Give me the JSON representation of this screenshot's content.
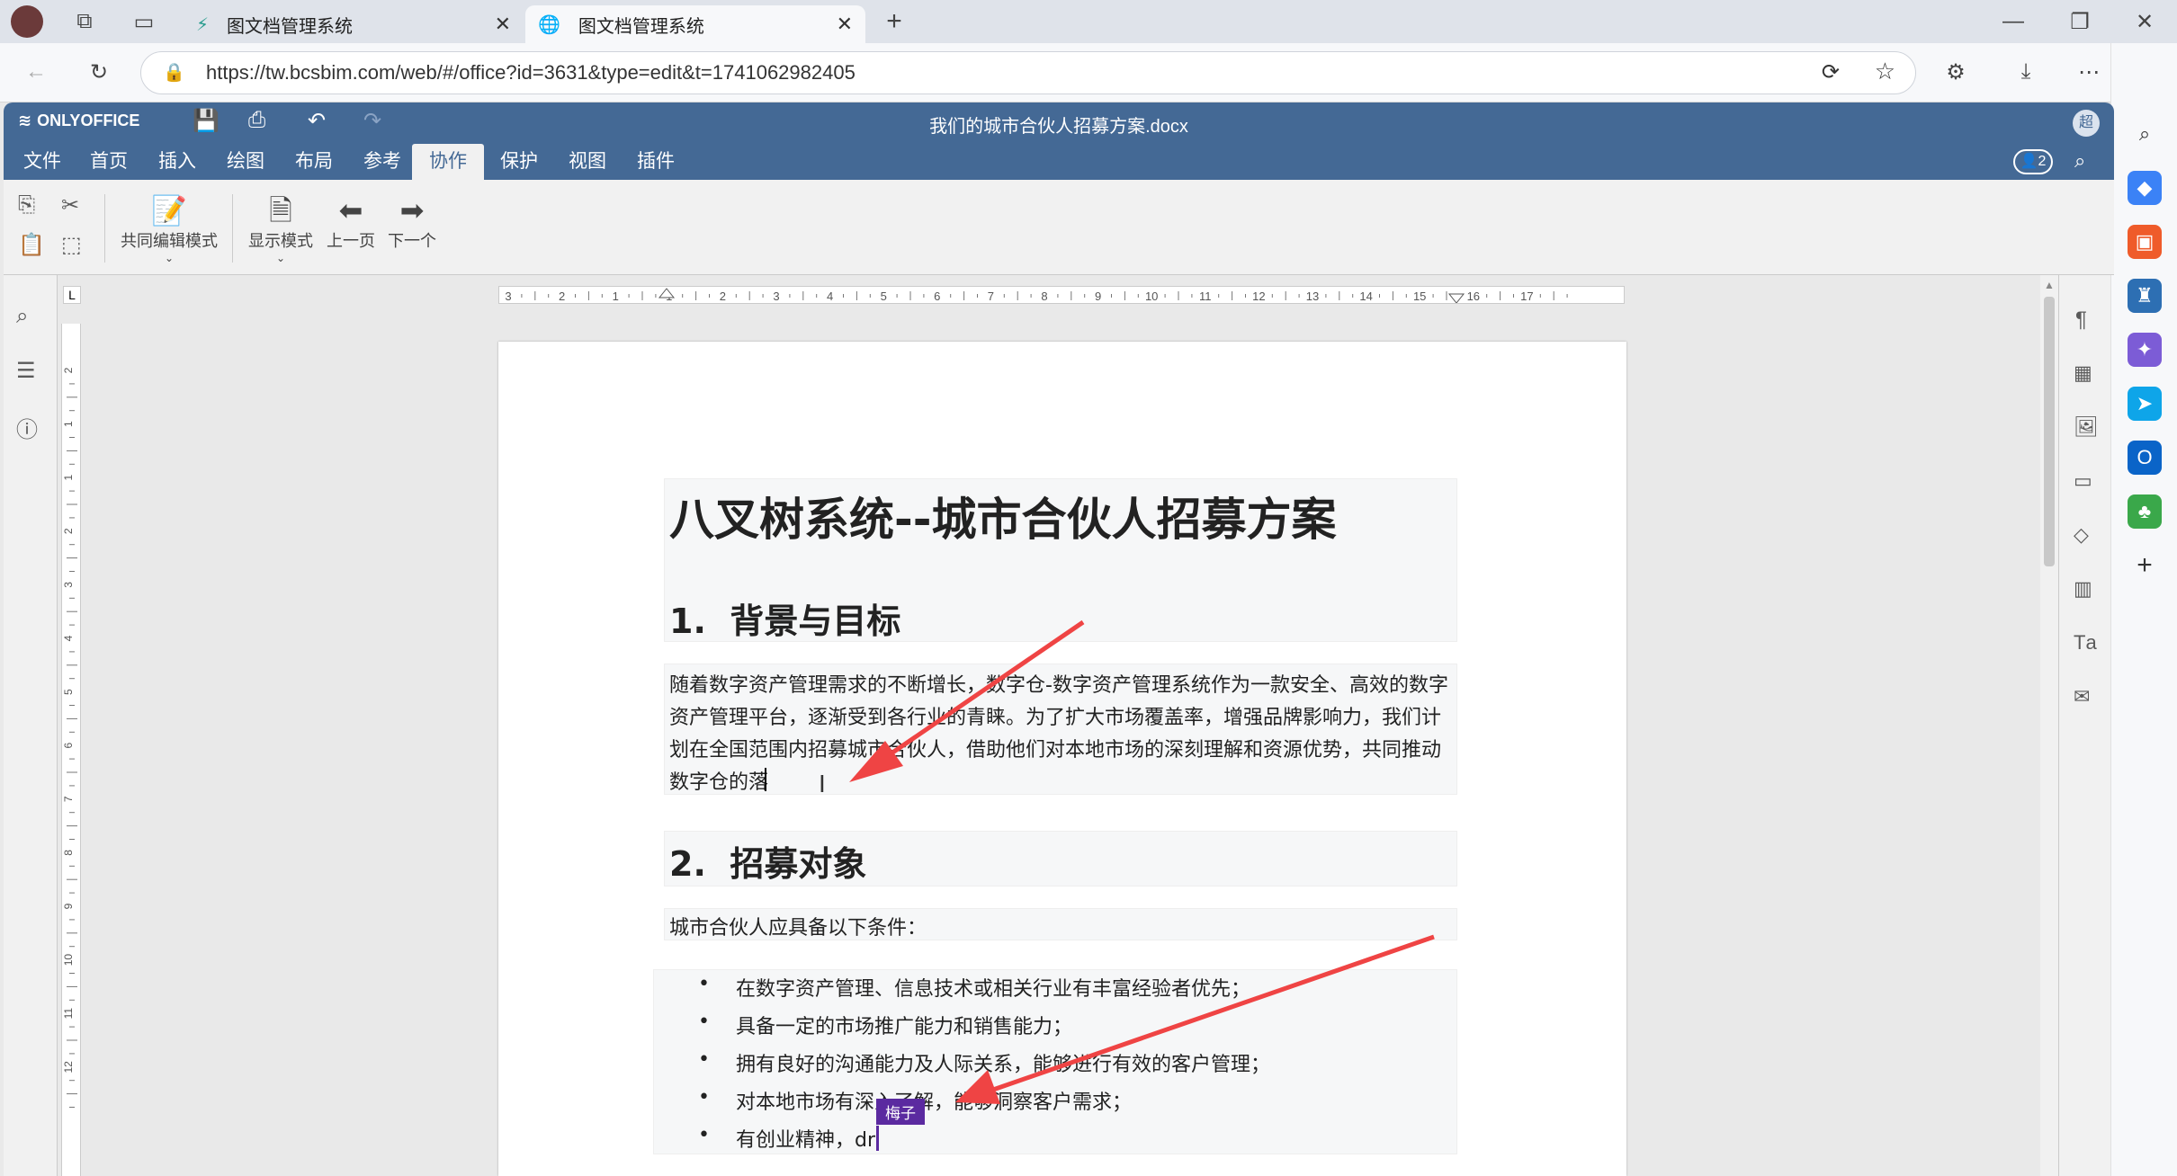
{
  "browser": {
    "tabs": [
      {
        "title": "图文档管理系统",
        "active": false
      },
      {
        "title": "图文档管理系统",
        "active": true
      }
    ],
    "url": "https://tw.bcsbim.com/web/#/office?id=3631&type=edit&t=1741062982405"
  },
  "app": {
    "brand": "ONLYOFFICE",
    "doc_title": "我们的城市合伙人招募方案.docx",
    "user_initial": "超",
    "online_count": "2",
    "menu": [
      "文件",
      "首页",
      "插入",
      "绘图",
      "布局",
      "参考",
      "协作",
      "保护",
      "视图",
      "插件"
    ],
    "active_menu": "协作"
  },
  "toolbar": {
    "coedit_label": "共同编辑模式",
    "display_mode_label": "显示模式",
    "prev_label": "上一页",
    "next_label": "下一个"
  },
  "ruler": {
    "h_labels": [
      "3",
      "2",
      "1",
      "1",
      "2",
      "3",
      "4",
      "5",
      "6",
      "7",
      "8",
      "9",
      "10",
      "11",
      "12",
      "13",
      "14",
      "15",
      "16",
      "17"
    ],
    "v_labels": [
      "2",
      "1",
      "1",
      "2",
      "3",
      "4",
      "5",
      "6",
      "7",
      "8",
      "9",
      "10",
      "11",
      "12"
    ]
  },
  "document": {
    "title": "八叉树系统--城市合伙人招募方案",
    "h1": "1.  背景与目标",
    "para1": [
      "随着数字资产管理需求的不断增长，数字仓-数字资产管理系统作为一款安全、高效的数字",
      "资产管理平台，逐渐受到各行业的青睐。为了扩大市场覆盖率，增强品牌影响力，我们计",
      "划在全国范围内招募城市合伙人，借助他们对本地市场的深刻理解和资源优势，共同推动",
      "数字仓的落"
    ],
    "h2": "2.  招募对象",
    "intro": "城市合伙人应具备以下条件：",
    "bullets": [
      "在数字资产管理、信息技术或相关行业有丰富经验者优先；",
      "具备一定的市场推广能力和销售能力；",
      "拥有良好的沟通能力及人际关系，能够进行有效的客户管理；",
      "对本地市场有深入了解，能够洞察客户需求；",
      "有创业精神，dr"
    ],
    "collab_user": "梅子"
  },
  "colors": {
    "header_bg": "#446995",
    "annotation_arrow": "#ef4444",
    "collab_cursor": "#5b2aa0"
  }
}
